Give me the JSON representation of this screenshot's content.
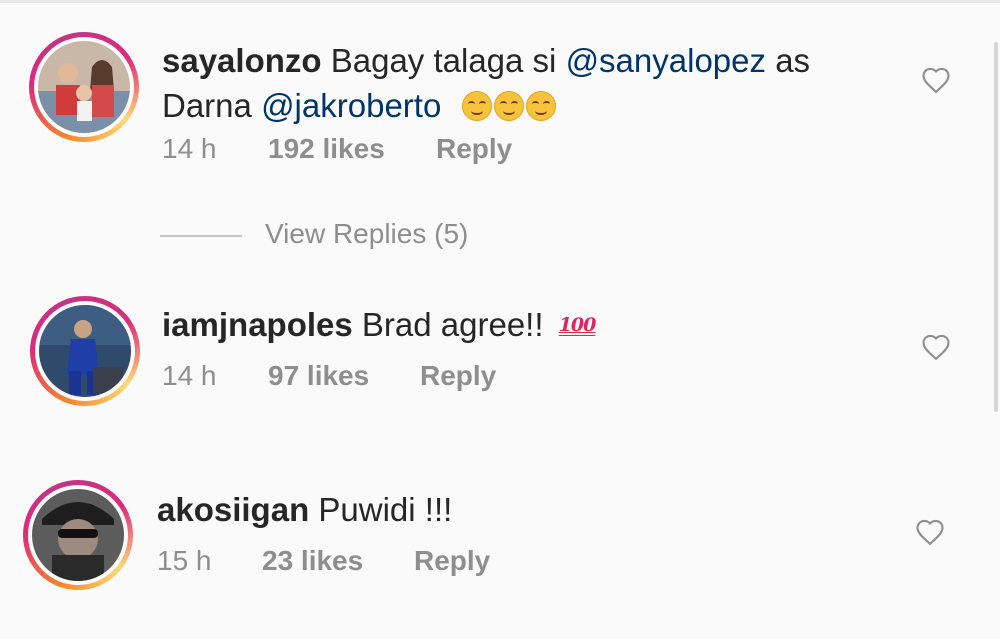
{
  "comments": [
    {
      "username": "sayalonzo",
      "text_1": "Bagay talaga si",
      "mention_1": "@sanyalopez",
      "text_2": "as",
      "text_3": "Darna",
      "mention_2": "@jakroberto",
      "emoji": "smiling-face-emoji",
      "time": "14 h",
      "likes": "192 likes",
      "reply": "Reply"
    },
    {
      "username": "iamjnapoles",
      "text": "Brad agree!!",
      "badge": "100",
      "time": "14 h",
      "likes": "97 likes",
      "reply": "Reply"
    },
    {
      "username": "akosiigan",
      "text": "Puwidi !!!",
      "time": "15 h",
      "likes": "23 likes",
      "reply": "Reply"
    }
  ],
  "view_replies": "View Replies (5)",
  "icons": {
    "like": "heart-outline-icon"
  },
  "colors": {
    "mention": "#003569",
    "meta": "#8e8e8e",
    "ring_start": "#f58529",
    "ring_mid": "#dd2a7b",
    "ring_end": "#feda75"
  }
}
